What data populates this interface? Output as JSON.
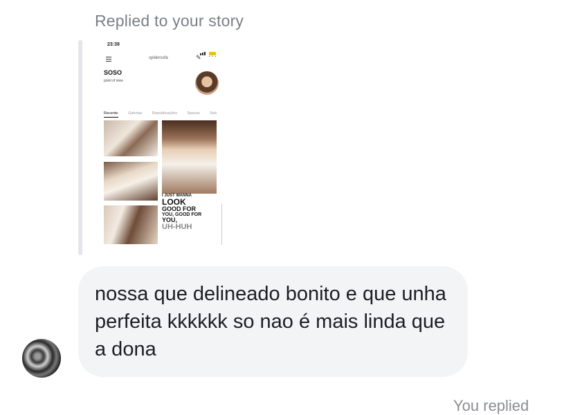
{
  "reply_header": "Replied to your story",
  "story": {
    "status_time": "23:38",
    "username": "spidersofa",
    "profile_name": "SOSO",
    "bio": "point of view",
    "tabs": [
      "Recente",
      "Galerias",
      "Republicações",
      "Spaces",
      "Sob"
    ],
    "lyrics": {
      "line1": "I JUST WANNA",
      "line2": "LOOK",
      "line3": "GOOD FOR",
      "line4": "YOU, GOOD FOR",
      "line5": "YOU,",
      "line6": "UH-HUH"
    }
  },
  "message": {
    "text": "nossa que delineado bonito e que unha perfeita kkkkkk so nao é mais linda que a dona"
  },
  "footer_partial": "You replied"
}
